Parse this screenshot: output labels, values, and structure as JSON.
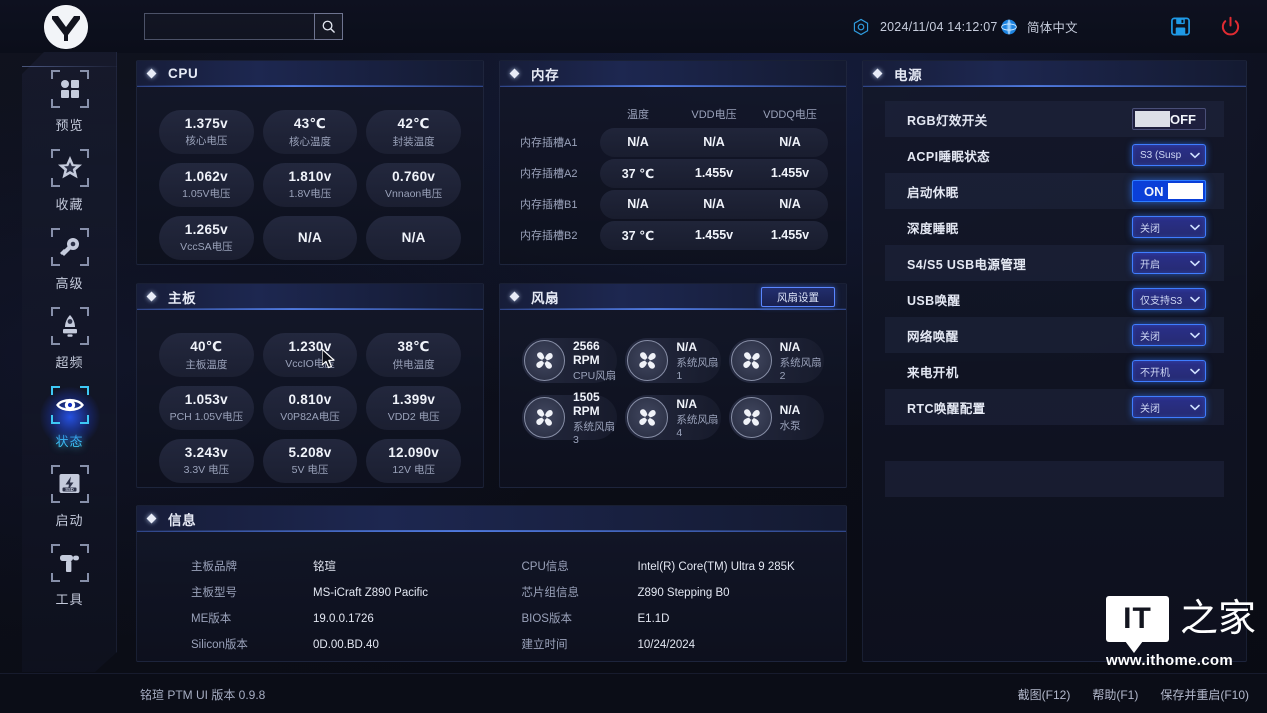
{
  "topbar": {
    "logo_name": "mingxuan-logo",
    "search_placeholder": "",
    "search_value": "",
    "search_icon": "magnifier-icon",
    "datetime_icon": "clock-hex-icon",
    "datetime": "2024/11/04 14:12:07",
    "language_icon": "globe-icon",
    "language": "简体中文",
    "save_icon": "floppy-save-icon",
    "power_icon": "power-off-icon"
  },
  "sidebar": {
    "items": [
      {
        "label": "预览",
        "icon": "grid-squares-icon",
        "active": false
      },
      {
        "label": "收藏",
        "icon": "star-icon",
        "active": false
      },
      {
        "label": "高级",
        "icon": "wrench-gear-icon",
        "active": false
      },
      {
        "label": "超频",
        "icon": "rocket-icon",
        "active": false
      },
      {
        "label": "状态",
        "icon": "eye-target-icon",
        "active": true
      },
      {
        "label": "启动",
        "icon": "ssd-bolt-icon",
        "active": false
      },
      {
        "label": "工具",
        "icon": "drill-tool-icon",
        "active": false
      }
    ]
  },
  "cpu_panel": {
    "title": "CPU",
    "cells": [
      {
        "value": "1.375v",
        "label": "核心电压"
      },
      {
        "value": "43℃",
        "label": "核心温度"
      },
      {
        "value": "42℃",
        "label": "封装温度"
      },
      {
        "value": "1.062v",
        "label": "1.05V电压"
      },
      {
        "value": "1.810v",
        "label": "1.8V电压"
      },
      {
        "value": "0.760v",
        "label": "Vnnaon电压"
      },
      {
        "value": "1.265v",
        "label": "VccSA电压"
      },
      {
        "value": "N/A",
        "label": ""
      },
      {
        "value": "N/A",
        "label": ""
      }
    ]
  },
  "mb_panel": {
    "title": "主板",
    "cells": [
      {
        "value": "40℃",
        "label": "主板温度"
      },
      {
        "value": "1.230v",
        "label": "VccIO电压"
      },
      {
        "value": "38℃",
        "label": "供电温度"
      },
      {
        "value": "1.053v",
        "label": "PCH 1.05V电压"
      },
      {
        "value": "0.810v",
        "label": "V0P82A电压"
      },
      {
        "value": "1.399v",
        "label": "VDD2 电压"
      },
      {
        "value": "3.243v",
        "label": "3.3V 电压"
      },
      {
        "value": "5.208v",
        "label": "5V 电压"
      },
      {
        "value": "12.090v",
        "label": "12V 电压"
      }
    ]
  },
  "mem_panel": {
    "title": "内存",
    "columns": [
      "温度",
      "VDD电压",
      "VDDQ电压"
    ],
    "rows": [
      {
        "name": "内存插槽A1",
        "values": [
          "N/A",
          "N/A",
          "N/A"
        ]
      },
      {
        "name": "内存插槽A2",
        "values": [
          "37 ℃",
          "1.455v",
          "1.455v"
        ]
      },
      {
        "name": "内存插槽B1",
        "values": [
          "N/A",
          "N/A",
          "N/A"
        ]
      },
      {
        "name": "内存插槽B2",
        "values": [
          "37 ℃",
          "1.455v",
          "1.455v"
        ]
      }
    ]
  },
  "fan_panel": {
    "title": "风扇",
    "settings_button": "风扇设置",
    "fans": [
      {
        "value": "2566 RPM",
        "label": "CPU风扇"
      },
      {
        "value": "N/A",
        "label": "系统风扇1"
      },
      {
        "value": "N/A",
        "label": "系统风扇2"
      },
      {
        "value": "1505 RPM",
        "label": "系统风扇3"
      },
      {
        "value": "N/A",
        "label": "系统风扇4"
      },
      {
        "value": "N/A",
        "label": "水泵"
      }
    ]
  },
  "info_panel": {
    "title": "信息",
    "left": [
      {
        "key": "主板品牌",
        "value": "铭瑄"
      },
      {
        "key": "主板型号",
        "value": "MS-iCraft Z890 Pacific"
      },
      {
        "key": "ME版本",
        "value": "19.0.0.1726"
      },
      {
        "key": "Silicon版本",
        "value": "0D.00.BD.40"
      }
    ],
    "right": [
      {
        "key": "CPU信息",
        "value": "Intel(R) Core(TM) Ultra 9 285K"
      },
      {
        "key": "芯片组信息",
        "value": "Z890 Stepping B0"
      },
      {
        "key": "BIOS版本",
        "value": "E1.1D"
      },
      {
        "key": "建立时间",
        "value": "10/24/2024"
      }
    ]
  },
  "power_panel": {
    "title": "电源",
    "rows": [
      {
        "label": "RGB灯效开关",
        "type": "toggle",
        "state": "off",
        "value": "OFF"
      },
      {
        "label": "ACPI睡眠状态",
        "type": "dropdown",
        "value": "S3 (Susp"
      },
      {
        "label": "启动休眠",
        "type": "toggle",
        "state": "on",
        "value": "ON"
      },
      {
        "label": "深度睡眠",
        "type": "dropdown",
        "value": "关闭"
      },
      {
        "label": "S4/S5 USB电源管理",
        "type": "dropdown",
        "value": "开启"
      },
      {
        "label": "USB唤醒",
        "type": "dropdown",
        "value": "仅支持S3"
      },
      {
        "label": "网络唤醒",
        "type": "dropdown",
        "value": "关闭"
      },
      {
        "label": "来电开机",
        "type": "dropdown",
        "value": "不开机"
      },
      {
        "label": "RTC唤醒配置",
        "type": "dropdown",
        "value": "关闭"
      },
      {
        "label": "",
        "type": "none",
        "value": ""
      },
      {
        "label": "",
        "type": "none",
        "value": ""
      }
    ]
  },
  "bottombar": {
    "version": "铭瑄 PTM UI 版本 0.9.8",
    "fkeys": [
      "截图(F12)",
      "帮助(F1)",
      "保存并重启(F10)"
    ]
  },
  "watermark": {
    "badge": "IT",
    "cn": "之家",
    "url": "www.ithome.com"
  },
  "colors": {
    "accent_blue": "#3f7dff",
    "active_cyan": "#3ec8f5",
    "power_red": "#e02b32",
    "toggle_on": "#0a3fd8"
  }
}
